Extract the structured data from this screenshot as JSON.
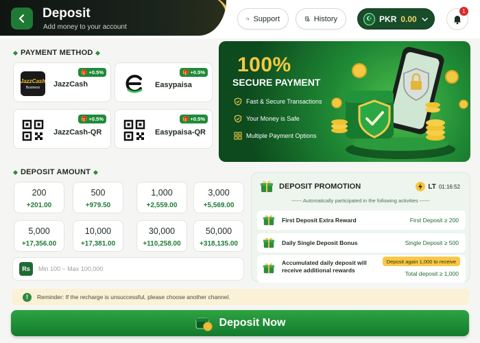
{
  "header": {
    "title": "Deposit",
    "subtitle": "Add money to your account",
    "support_label": "Support",
    "history_label": "History",
    "currency": "PKR",
    "balance": "0.00",
    "notification_count": "1"
  },
  "payment_method": {
    "section_title": "PAYMENT METHOD",
    "methods": [
      {
        "name": "JazzCash",
        "bonus": "+0.5%",
        "logo_text": "JazzCash",
        "logo_sub": "Business"
      },
      {
        "name": "Easypaisa",
        "bonus": "+0.5%"
      },
      {
        "name": "JazzCash-QR",
        "bonus": "+0.5%"
      },
      {
        "name": "Easypaisa-QR",
        "bonus": "+0.5%"
      }
    ]
  },
  "banner": {
    "headline": "100%",
    "subheadline": "SECURE PAYMENT",
    "features": [
      "Fast & Secure Transactions",
      "Your Money is Safe",
      "Multiple Payment Options"
    ]
  },
  "deposit_amount": {
    "section_title": "DEPOSIT AMOUNT",
    "options": [
      {
        "value": "200",
        "bonus": "+201.00"
      },
      {
        "value": "500",
        "bonus": "+979.50"
      },
      {
        "value": "1,000",
        "bonus": "+2,559.00"
      },
      {
        "value": "3,000",
        "bonus": "+5,569.00"
      },
      {
        "value": "5,000",
        "bonus": "+17,356.00"
      },
      {
        "value": "10,000",
        "bonus": "+17,381.00"
      },
      {
        "value": "30,000",
        "bonus": "+110,258.00"
      },
      {
        "value": "50,000",
        "bonus": "+318,135.00"
      }
    ],
    "currency_symbol": "Rs",
    "placeholder": "Min 100 ~ Max 100,000",
    "value": ""
  },
  "promotion": {
    "title": "DEPOSIT PROMOTION",
    "timer_label": "LT",
    "timer": "01:16:52",
    "auto_note": "------ Automatically participated in the following activities ------",
    "items": [
      {
        "name": "First Deposit Extra Reward",
        "condition": "First Deposit ≥ 200"
      },
      {
        "name": "Daily Single Deposit Bonus",
        "condition": "Single Deposit ≥ 500"
      },
      {
        "name": "Accumulated daily deposit will receive additional rewards",
        "tag": "Deposit again 1,000 to receive",
        "condition": "Total deposit ≥ 1,000"
      }
    ]
  },
  "reminder": {
    "text": "Reminder:  If the recharge is unsuccessful, please choose another channel."
  },
  "deposit_button": {
    "label": "Deposit Now"
  },
  "colors": {
    "primary_green": "#1f7a35",
    "accent_gold": "#f5c842",
    "reminder_bg": "#fbf1d6"
  }
}
